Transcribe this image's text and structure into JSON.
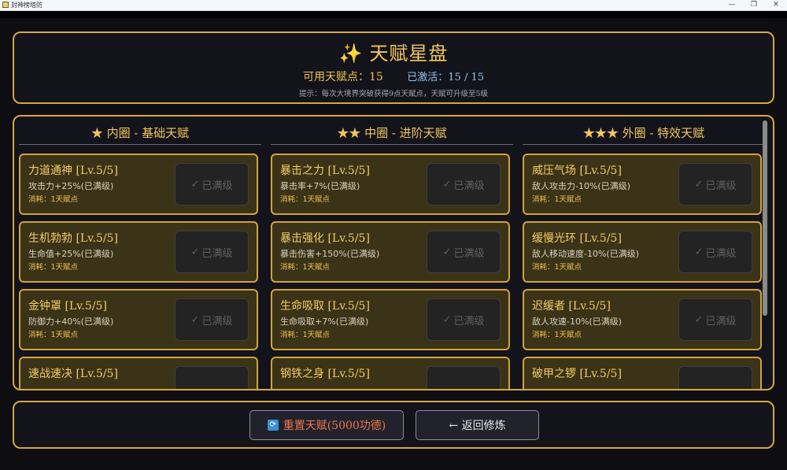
{
  "window": {
    "title": "封神榜塔防"
  },
  "header": {
    "title": "天赋星盘",
    "points_label": "可用天赋点：",
    "points_value": "15",
    "activated_label": "已激活：",
    "activated_value": "15 / 15",
    "hint": "提示：每次大境界突破获得9点天赋点，天赋可升级至5级"
  },
  "columns": [
    {
      "title": "★ 内圈 - 基础天赋",
      "talents": [
        {
          "name": "力道通神 [Lv.5/5]",
          "desc": "攻击力+25%(已满级)",
          "cost": "消耗：1天赋点",
          "button": "已满级"
        },
        {
          "name": "生机勃勃 [Lv.5/5]",
          "desc": "生命值+25%(已满级)",
          "cost": "消耗：1天赋点",
          "button": "已满级"
        },
        {
          "name": "金钟罩 [Lv.5/5]",
          "desc": "防御力+40%(已满级)",
          "cost": "消耗：1天赋点",
          "button": "已满级"
        },
        {
          "name": "速战速决 [Lv.5/5]",
          "desc": "",
          "cost": "",
          "button": ""
        }
      ]
    },
    {
      "title": "★★ 中圈 - 进阶天赋",
      "talents": [
        {
          "name": "暴击之力 [Lv.5/5]",
          "desc": "暴击率+7%(已满级)",
          "cost": "消耗：1天赋点",
          "button": "已满级"
        },
        {
          "name": "暴击强化 [Lv.5/5]",
          "desc": "暴击伤害+150%(已满级)",
          "cost": "消耗：1天赋点",
          "button": "已满级"
        },
        {
          "name": "生命吸取 [Lv.5/5]",
          "desc": "生命吸取+7%(已满级)",
          "cost": "消耗：1天赋点",
          "button": "已满级"
        },
        {
          "name": "钢铁之身 [Lv.5/5]",
          "desc": "",
          "cost": "",
          "button": ""
        }
      ]
    },
    {
      "title": "★★★ 外圈 - 特效天赋",
      "talents": [
        {
          "name": "威压气场 [Lv.5/5]",
          "desc": "敌人攻击力-10%(已满级)",
          "cost": "消耗：1天赋点",
          "button": "已满级"
        },
        {
          "name": "缓慢光环 [Lv.5/5]",
          "desc": "敌人移动速度-10%(已满级)",
          "cost": "消耗：1天赋点",
          "button": "已满级"
        },
        {
          "name": "迟缓者 [Lv.5/5]",
          "desc": "敌人攻速-10%(已满级)",
          "cost": "消耗：1天赋点",
          "button": "已满级"
        },
        {
          "name": "破甲之锣 [Lv.5/5]",
          "desc": "",
          "cost": "",
          "button": ""
        }
      ]
    }
  ],
  "footer": {
    "reset_label": "重置天赋(5000功德)",
    "back_label": "← 返回修炼"
  },
  "colors": {
    "accent_gold": "#d8a640",
    "card_bg": "#3b3317",
    "reset_text": "#f0774a",
    "activated_text": "#8fc4ee"
  },
  "icons": {
    "title_icon": "sparkles-icon",
    "check": "check-icon",
    "reset": "refresh-icon"
  }
}
